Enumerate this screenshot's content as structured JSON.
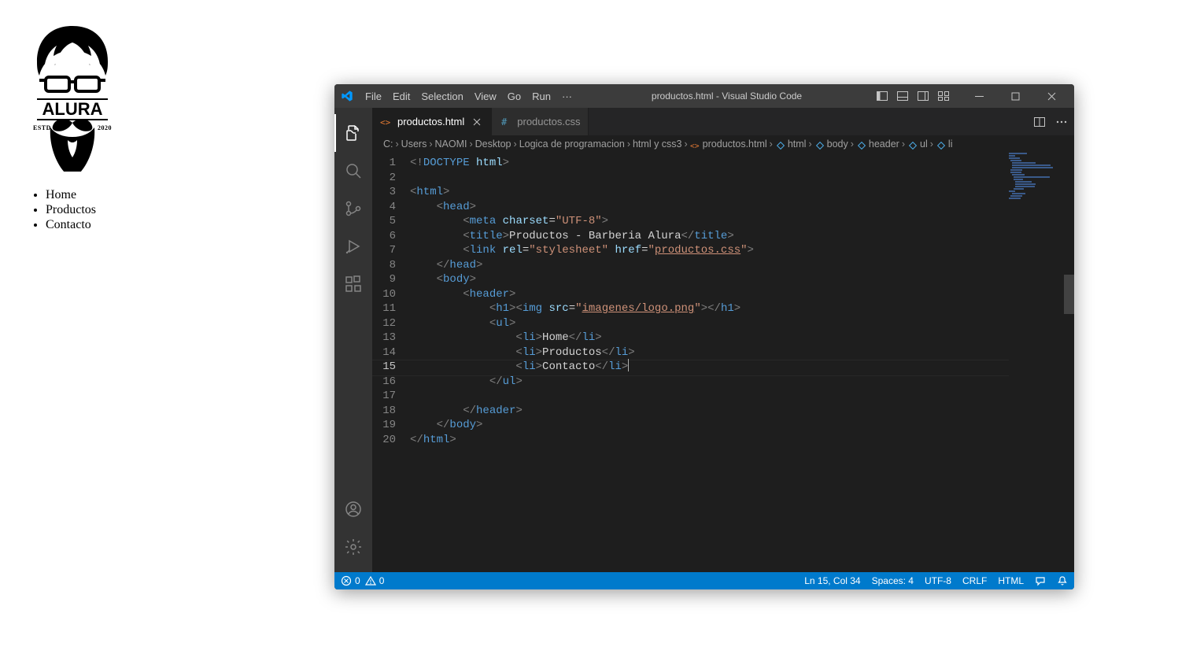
{
  "preview": {
    "logo_brand": "ALURA",
    "logo_estd": "ESTD",
    "logo_year": "2020",
    "nav": [
      "Home",
      "Productos",
      "Contacto"
    ]
  },
  "vscode": {
    "window_title": "productos.html - Visual Studio Code",
    "menu": [
      "File",
      "Edit",
      "Selection",
      "View",
      "Go",
      "Run"
    ],
    "menu_more": "···",
    "tabs": [
      {
        "label": "productos.html",
        "icon": "html-icon",
        "active": true,
        "dirty": false
      },
      {
        "label": "productos.css",
        "icon": "css-icon",
        "active": false,
        "dirty": false
      }
    ],
    "breadcrumbs": {
      "path": [
        "C:",
        "Users",
        "NAOMI",
        "Desktop",
        "Logica de programacion",
        "html y css3"
      ],
      "file": "productos.html",
      "symbols": [
        "html",
        "body",
        "header",
        "ul",
        "li"
      ]
    },
    "code": {
      "lines": [
        {
          "n": 1,
          "indent": 0,
          "frags": [
            [
              "gray",
              "<!"
            ],
            [
              "blue",
              "DOCTYPE "
            ],
            [
              "lblue",
              "html"
            ],
            [
              "gray",
              ">"
            ]
          ]
        },
        {
          "n": 2,
          "indent": 0,
          "frags": []
        },
        {
          "n": 3,
          "indent": 0,
          "frags": [
            [
              "gray",
              "<"
            ],
            [
              "blue",
              "html"
            ],
            [
              "gray",
              ">"
            ]
          ]
        },
        {
          "n": 4,
          "indent": 1,
          "frags": [
            [
              "gray",
              "<"
            ],
            [
              "blue",
              "head"
            ],
            [
              "gray",
              ">"
            ]
          ]
        },
        {
          "n": 5,
          "indent": 2,
          "frags": [
            [
              "gray",
              "<"
            ],
            [
              "blue",
              "meta "
            ],
            [
              "lblue",
              "charset"
            ],
            [
              "white",
              "="
            ],
            [
              "string",
              "\"UTF-8\""
            ],
            [
              "gray",
              ">"
            ]
          ]
        },
        {
          "n": 6,
          "indent": 2,
          "frags": [
            [
              "gray",
              "<"
            ],
            [
              "blue",
              "title"
            ],
            [
              "gray",
              ">"
            ],
            [
              "white",
              "Productos - Barberia Alura"
            ],
            [
              "gray",
              "</"
            ],
            [
              "blue",
              "title"
            ],
            [
              "gray",
              ">"
            ]
          ]
        },
        {
          "n": 7,
          "indent": 2,
          "frags": [
            [
              "gray",
              "<"
            ],
            [
              "blue",
              "link "
            ],
            [
              "lblue",
              "rel"
            ],
            [
              "white",
              "="
            ],
            [
              "string",
              "\"stylesheet\""
            ],
            [
              "white",
              " "
            ],
            [
              "lblue",
              "href"
            ],
            [
              "white",
              "="
            ],
            [
              "string",
              "\""
            ],
            [
              "ul",
              "productos.css"
            ],
            [
              "string",
              "\""
            ],
            [
              "gray",
              ">"
            ]
          ]
        },
        {
          "n": 8,
          "indent": 1,
          "frags": [
            [
              "gray",
              "</"
            ],
            [
              "blue",
              "head"
            ],
            [
              "gray",
              ">"
            ]
          ]
        },
        {
          "n": 9,
          "indent": 1,
          "frags": [
            [
              "gray",
              "<"
            ],
            [
              "blue",
              "body"
            ],
            [
              "gray",
              ">"
            ]
          ]
        },
        {
          "n": 10,
          "indent": 2,
          "frags": [
            [
              "gray",
              "<"
            ],
            [
              "blue",
              "header"
            ],
            [
              "gray",
              ">"
            ]
          ]
        },
        {
          "n": 11,
          "indent": 3,
          "frags": [
            [
              "gray",
              "<"
            ],
            [
              "blue",
              "h1"
            ],
            [
              "gray",
              ">"
            ],
            [
              "gray",
              "<"
            ],
            [
              "blue",
              "img "
            ],
            [
              "lblue",
              "src"
            ],
            [
              "white",
              "="
            ],
            [
              "string",
              "\""
            ],
            [
              "ul",
              "imagenes/logo.png"
            ],
            [
              "string",
              "\""
            ],
            [
              "gray",
              ">"
            ],
            [
              "gray",
              "</"
            ],
            [
              "blue",
              "h1"
            ],
            [
              "gray",
              ">"
            ]
          ]
        },
        {
          "n": 12,
          "indent": 3,
          "frags": [
            [
              "gray",
              "<"
            ],
            [
              "blue",
              "ul"
            ],
            [
              "gray",
              ">"
            ]
          ]
        },
        {
          "n": 13,
          "indent": 4,
          "frags": [
            [
              "gray",
              "<"
            ],
            [
              "blue",
              "li"
            ],
            [
              "gray",
              ">"
            ],
            [
              "white",
              "Home"
            ],
            [
              "gray",
              "</"
            ],
            [
              "blue",
              "li"
            ],
            [
              "gray",
              ">"
            ]
          ]
        },
        {
          "n": 14,
          "indent": 4,
          "frags": [
            [
              "gray",
              "<"
            ],
            [
              "blue",
              "li"
            ],
            [
              "gray",
              ">"
            ],
            [
              "white",
              "Productos"
            ],
            [
              "gray",
              "</"
            ],
            [
              "blue",
              "li"
            ],
            [
              "gray",
              ">"
            ]
          ]
        },
        {
          "n": 15,
          "indent": 4,
          "frags": [
            [
              "gray",
              "<"
            ],
            [
              "blue",
              "li"
            ],
            [
              "gray",
              ">"
            ],
            [
              "white",
              "Contacto"
            ],
            [
              "gray",
              "</"
            ],
            [
              "blue",
              "li"
            ],
            [
              "gray",
              ">"
            ]
          ],
          "cursor_after": true,
          "current": true
        },
        {
          "n": 16,
          "indent": 3,
          "frags": [
            [
              "gray",
              "</"
            ],
            [
              "blue",
              "ul"
            ],
            [
              "gray",
              ">"
            ]
          ]
        },
        {
          "n": 17,
          "indent": 0,
          "frags": []
        },
        {
          "n": 18,
          "indent": 2,
          "frags": [
            [
              "gray",
              "</"
            ],
            [
              "blue",
              "header"
            ],
            [
              "gray",
              ">"
            ]
          ]
        },
        {
          "n": 19,
          "indent": 1,
          "frags": [
            [
              "gray",
              "</"
            ],
            [
              "blue",
              "body"
            ],
            [
              "gray",
              ">"
            ]
          ]
        },
        {
          "n": 20,
          "indent": 0,
          "frags": [
            [
              "gray",
              "</"
            ],
            [
              "blue",
              "html"
            ],
            [
              "gray",
              ">"
            ]
          ]
        }
      ]
    },
    "status": {
      "errors": "0",
      "warnings": "0",
      "ln_col": "Ln 15, Col 34",
      "spaces": "Spaces: 4",
      "encoding": "UTF-8",
      "eol": "CRLF",
      "language": "HTML"
    }
  }
}
